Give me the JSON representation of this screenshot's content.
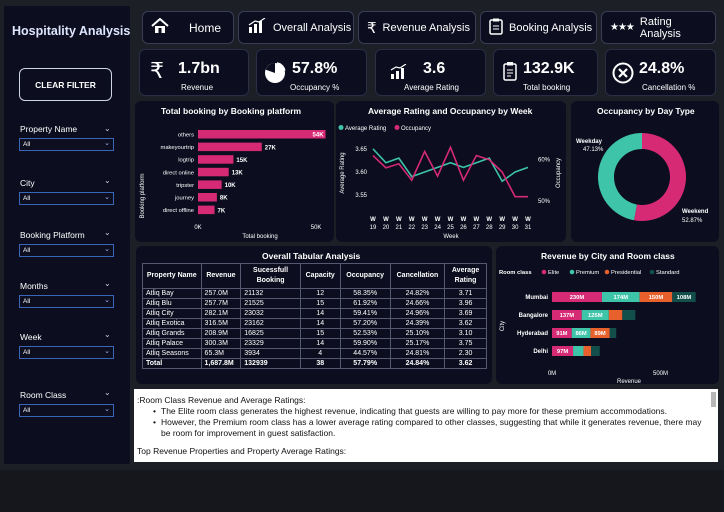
{
  "app_title": "Hospitality Analysis",
  "clear_filter": "CLEAR FILTER",
  "filters": [
    {
      "label": "Property Name",
      "value": "All"
    },
    {
      "label": "City",
      "value": "All"
    },
    {
      "label": "Booking Platform",
      "value": "All"
    },
    {
      "label": "Months",
      "value": "All"
    },
    {
      "label": "Week",
      "value": "All"
    },
    {
      "label": "Room Class",
      "value": "All"
    }
  ],
  "nav": [
    {
      "label": "Home",
      "icon": "home-icon"
    },
    {
      "label": "Overall Analysis",
      "icon": "bar-chart-icon"
    },
    {
      "label": "Revenue Analysis",
      "icon": "rupee-icon"
    },
    {
      "label": "Booking Analysis",
      "icon": "clipboard-icon"
    },
    {
      "label": "Rating Analysis",
      "icon": "stars-icon"
    }
  ],
  "kpis": [
    {
      "value": "1.7bn",
      "label": "Revenue",
      "icon": "rupee-icon"
    },
    {
      "value": "57.8%",
      "label": "Occupancy %",
      "icon": "pie-icon"
    },
    {
      "value": "3.6",
      "label": "Average Rating",
      "icon": "rating-bars-icon"
    },
    {
      "value": "132.9K",
      "label": "Total booking",
      "icon": "clipboard-icon"
    },
    {
      "value": "24.8%",
      "label": "Cancellation %",
      "icon": "cancel-icon"
    }
  ],
  "colors": {
    "accent": "#d62a74",
    "teal": "#3ec4a8",
    "orange": "#e8612c",
    "dark_green": "#134f4a",
    "panel": "#0c0d1e"
  },
  "chart_data": [
    {
      "type": "bar",
      "title": "Total booking by Booking platform",
      "xlabel": "Total booking",
      "ylabel": "Booking platform",
      "categories": [
        "others",
        "makeyourtrip",
        "logtrip",
        "direct online",
        "tripster",
        "journey",
        "direct offline"
      ],
      "values": [
        54000,
        27000,
        15000,
        13000,
        10000,
        8000,
        7000
      ],
      "labels": [
        "54K",
        "27K",
        "15K",
        "13K",
        "10K",
        "8K",
        "7K"
      ],
      "xticks": [
        "0K",
        "50K"
      ],
      "xlim": [
        0,
        58000
      ]
    },
    {
      "type": "line",
      "title": "Average Rating and Occupancy by Week",
      "xlabel": "Week",
      "ylabel": "Average Rating",
      "y2label": "Occupancy",
      "x": [
        "W 19",
        "W 20",
        "W 21",
        "W 22",
        "W 23",
        "W 24",
        "W 25",
        "W 26",
        "W 27",
        "W 28",
        "W 29",
        "W 30",
        "W 31"
      ],
      "yticks": [
        "3.55",
        "3.60",
        "3.65"
      ],
      "y2ticks": [
        "50%",
        "60%"
      ],
      "ylim": [
        3.52,
        3.68
      ],
      "y2lim": [
        0.48,
        0.66
      ],
      "series": [
        {
          "name": "Average Rating",
          "color": "#3ec4a8",
          "values": [
            3.65,
            3.62,
            3.63,
            3.59,
            3.6,
            3.61,
            3.62,
            3.61,
            3.62,
            3.63,
            3.58,
            3.6,
            3.61
          ]
        },
        {
          "name": "Occupancy",
          "color": "#d62a74",
          "values": [
            0.61,
            0.58,
            0.59,
            0.55,
            0.62,
            0.56,
            0.63,
            0.55,
            0.61,
            0.6,
            0.57,
            0.51,
            0.51
          ]
        }
      ]
    },
    {
      "type": "pie",
      "title": "Occupancy by Day Type",
      "labels": [
        "Weekday",
        "Weekend"
      ],
      "values": [
        47.13,
        52.87
      ],
      "value_labels": [
        "47.13%",
        "52.87%"
      ],
      "colors": [
        "#3ec4a8",
        "#d62a74"
      ]
    },
    {
      "type": "bar",
      "title": "Revenue by City and Room class",
      "legend_title": "Room class",
      "xlabel": "Revenue",
      "ylabel": "City",
      "categories": [
        "Mumbai",
        "Bangalore",
        "Hyderabad",
        "Delhi"
      ],
      "xticks": [
        "0M",
        "500M"
      ],
      "xlim": [
        0,
        720
      ],
      "series": [
        {
          "name": "Elite",
          "color": "#d62a74",
          "values": [
            230,
            137,
            91,
            97
          ],
          "labels": [
            "230M",
            "137M",
            "91M",
            "97M"
          ]
        },
        {
          "name": "Premium",
          "color": "#3ec4a8",
          "values": [
            174,
            125,
            86,
            48
          ],
          "labels": [
            "174M",
            "125M",
            "86M",
            ""
          ]
        },
        {
          "name": "Presidential",
          "color": "#e8612c",
          "values": [
            150,
            62,
            89,
            35
          ],
          "labels": [
            "150M",
            "",
            "89M",
            ""
          ]
        },
        {
          "name": "Standard",
          "color": "#134f4a",
          "values": [
            108,
            60,
            30,
            40
          ],
          "labels": [
            "108M",
            "",
            "",
            ""
          ]
        }
      ]
    },
    {
      "type": "table",
      "title": "Overall Tabular Analysis",
      "columns": [
        "Property Name",
        "Revenue",
        "Sucessfull Booking",
        "Capacity",
        "Occupancy",
        "Cancellation",
        "Average Rating"
      ],
      "rows": [
        [
          "Atliq Bay",
          "257.0M",
          "21132",
          "12",
          "58.35%",
          "24.82%",
          "3.71"
        ],
        [
          "Atliq Blu",
          "257.7M",
          "21525",
          "15",
          "61.92%",
          "24.66%",
          "3.96"
        ],
        [
          "Atliq City",
          "282.1M",
          "23032",
          "14",
          "59.41%",
          "24.96%",
          "3.69"
        ],
        [
          "Atliq Exotica",
          "316.5M",
          "23162",
          "14",
          "57.20%",
          "24.39%",
          "3.62"
        ],
        [
          "Atliq Grands",
          "208.9M",
          "16825",
          "15",
          "52.53%",
          "25.10%",
          "3.10"
        ],
        [
          "Atliq Palace",
          "300.3M",
          "23329",
          "14",
          "59.90%",
          "25.17%",
          "3.75"
        ],
        [
          "Atliq Seasons",
          "65.3M",
          "3934",
          "4",
          "44.57%",
          "24.81%",
          "2.30"
        ]
      ],
      "total": [
        "Total",
        "1,687.8M",
        "132939",
        "38",
        "57.79%",
        "24.84%",
        "3.62"
      ]
    }
  ],
  "notes": {
    "heading1": ":Room Class Revenue and Average Ratings:",
    "bullet1": "The Elite room class generates the highest revenue, indicating that guests are willing to pay more for these premium accommodations.",
    "bullet2": "However, the Premium room class has a lower average rating compared to other classes, suggesting that while it generates revenue, there may be room for improvement in guest satisfaction.",
    "heading2": "Top Revenue Properties and Property Average Ratings:"
  }
}
